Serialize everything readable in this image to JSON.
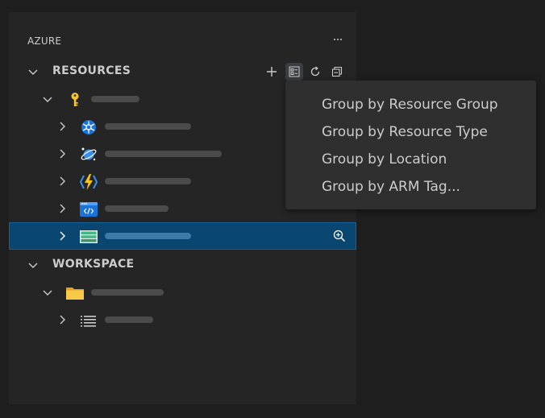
{
  "panel": {
    "title": "AZURE"
  },
  "sections": {
    "resources": {
      "label": "RESOURCES"
    },
    "workspace": {
      "label": "WORKSPACE"
    }
  },
  "toolbar": {
    "icons": [
      "add-icon",
      "group-by-icon",
      "refresh-icon",
      "collapse-all-icon"
    ]
  },
  "resources_tree": {
    "subscription_icon": "key-icon",
    "items": [
      {
        "icon": "kubernetes-icon"
      },
      {
        "icon": "cosmos-db-icon"
      },
      {
        "icon": "function-app-icon"
      },
      {
        "icon": "static-web-app-icon"
      },
      {
        "icon": "storage-account-icon",
        "selected": true,
        "action_icon": "zoom-in-icon"
      }
    ]
  },
  "workspace_tree": {
    "folder_icon": "folder-icon",
    "items": [
      {
        "icon": "list-icon"
      }
    ]
  },
  "context_menu": {
    "items": [
      "Group by Resource Group",
      "Group by Resource Type",
      "Group by Location",
      "Group by ARM Tag..."
    ]
  },
  "colors": {
    "background": "#1e1e1e",
    "panel": "#252526",
    "selection": "#094771",
    "menu": "#2f2f2f"
  }
}
